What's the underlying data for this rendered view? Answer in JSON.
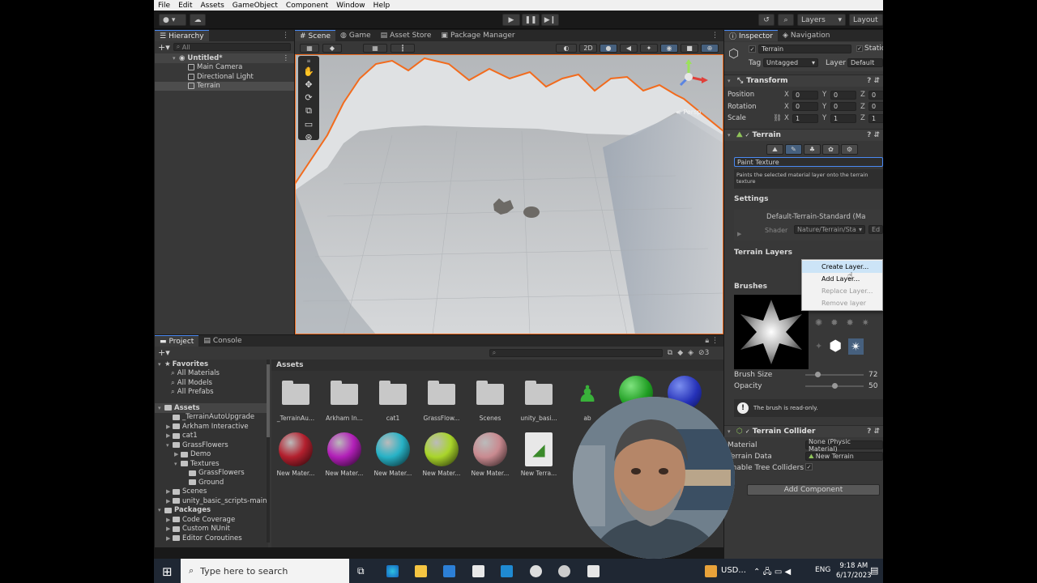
{
  "menu": [
    "File",
    "Edit",
    "Assets",
    "GameObject",
    "Component",
    "Window",
    "Help"
  ],
  "toolbar": {
    "layers": "Layers",
    "layout": "Layout"
  },
  "hierarchy": {
    "tab": "Hierarchy",
    "search": "All",
    "scene": "Untitled*",
    "items": [
      "Main Camera",
      "Directional Light",
      "Terrain"
    ]
  },
  "scene_tabs": [
    "Scene",
    "Game",
    "Asset Store",
    "Package Manager"
  ],
  "scene": {
    "mode2d": "2D",
    "persp": "< Persp"
  },
  "inspector": {
    "tabs": [
      "Inspector",
      "Navigation"
    ],
    "object_name": "Terrain",
    "static_label": "Static",
    "tag_label": "Tag",
    "tag_value": "Untagged",
    "layer_label": "Layer",
    "layer_value": "Default",
    "transform": {
      "title": "Transform",
      "rows": [
        {
          "label": "Position",
          "x": "0",
          "y": "0",
          "z": "0"
        },
        {
          "label": "Rotation",
          "x": "0",
          "y": "0",
          "z": "0"
        },
        {
          "label": "Scale",
          "x": "1",
          "y": "1",
          "z": "1"
        }
      ]
    },
    "terrain": {
      "title": "Terrain",
      "tool": "Paint Texture",
      "help": "Paints the selected material layer onto the terrain texture",
      "settings": "Settings",
      "material": "Default-Terrain-Standard (Ma",
      "shader_label": "Shader",
      "shader_value": "Nature/Terrain/Sta",
      "shader_edit": "Ed",
      "layers_label": "Terrain Layers",
      "brushes_label": "Brushes",
      "brush_size_label": "Brush Size",
      "brush_size": "72",
      "opacity_label": "Opacity",
      "opacity": "50",
      "readonly": "The brush is read-only."
    },
    "collider": {
      "title": "Terrain Collider",
      "material_label": "Material",
      "material_value": "None (Physic Material)",
      "data_label": "Terrain Data",
      "data_value": "New Terrain",
      "trees_label": "Enable Tree Colliders"
    },
    "add_component": "Add Component"
  },
  "context_menu": [
    "Create Layer...",
    "Add Layer...",
    "Replace Layer...",
    "Remove layer"
  ],
  "project": {
    "tabs": [
      "Project",
      "Console"
    ],
    "favorites_title": "Favorites",
    "favorites": [
      "All Materials",
      "All Models",
      "All Prefabs"
    ],
    "assets_title": "Assets",
    "tree": [
      {
        "label": "_TerrainAutoUpgrade",
        "depth": 1
      },
      {
        "label": "Arkham Interactive",
        "depth": 1
      },
      {
        "label": "cat1",
        "depth": 1
      },
      {
        "label": "GrassFlowers",
        "depth": 1
      },
      {
        "label": "Demo",
        "depth": 2
      },
      {
        "label": "Textures",
        "depth": 2
      },
      {
        "label": "GrassFlowers",
        "depth": 3
      },
      {
        "label": "Ground",
        "depth": 3
      },
      {
        "label": "Scenes",
        "depth": 1
      },
      {
        "label": "unity_basic_scripts-main",
        "depth": 1
      }
    ],
    "packages_title": "Packages",
    "packages": [
      "Code Coverage",
      "Custom NUnit",
      "Editor Coroutines"
    ],
    "breadcrumb": "Assets",
    "count": "3",
    "folders": [
      "_TerrainAu...",
      "Arkham In...",
      "cat1",
      "GrassFlow...",
      "Scenes",
      "unity_basi..."
    ],
    "materials": [
      {
        "label": "New Mater...",
        "color": "#b3202e"
      },
      {
        "label": "New Mater...",
        "color": "#b21fb8"
      },
      {
        "label": "New Mater...",
        "color": "#27b2c6"
      },
      {
        "label": "New Mater...",
        "color": "#a9d52a"
      },
      {
        "label": "New Mater...",
        "color": "#c98a90"
      }
    ],
    "terrain_asset": "New Terra...",
    "extra_label": "ab"
  },
  "taskbar": {
    "search": "Type here to search",
    "stock": "USD...",
    "lang": "ENG",
    "time": "9:18 AM",
    "date": "6/17/2023"
  },
  "colors": {
    "accent": "#4a8af4",
    "selection_outline": "#f26b1d"
  }
}
